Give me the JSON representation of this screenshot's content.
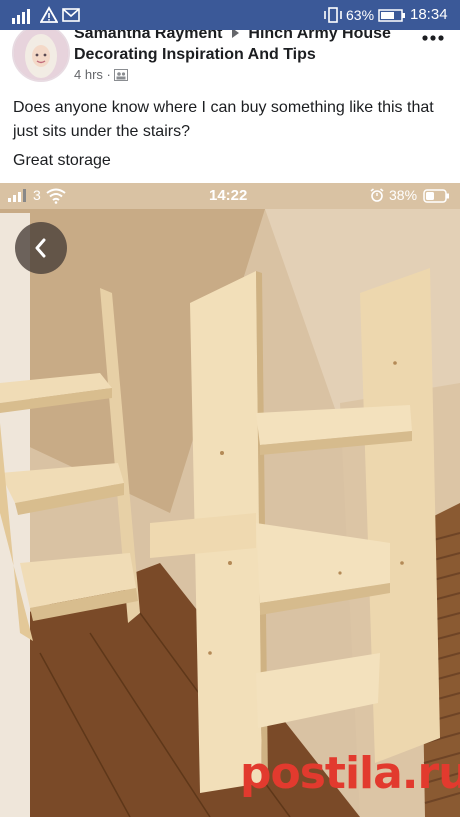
{
  "status_bar": {
    "left_icons": [
      "signal-icon",
      "warning-icon",
      "mail-icon"
    ],
    "battery": "63%",
    "time": "18:34"
  },
  "post": {
    "author": "Samantha Rayment",
    "group": "Hinch Army House",
    "group_cont": "Decorating Inspiration And Tips",
    "time_ago": "4 hrs",
    "body": "Does anyone know where I can buy something like this that just sits under the stairs?",
    "body2": "Great storage"
  },
  "photo": {
    "status_carrier": "3",
    "status_time": "14:22",
    "status_battery": "38%",
    "watermark": "postila.ru"
  },
  "colors": {
    "status_bar_bg": "#3b5998",
    "wood": "#e6cfa4",
    "floor": "#7a4a28",
    "watermark": "#e23a2e"
  }
}
